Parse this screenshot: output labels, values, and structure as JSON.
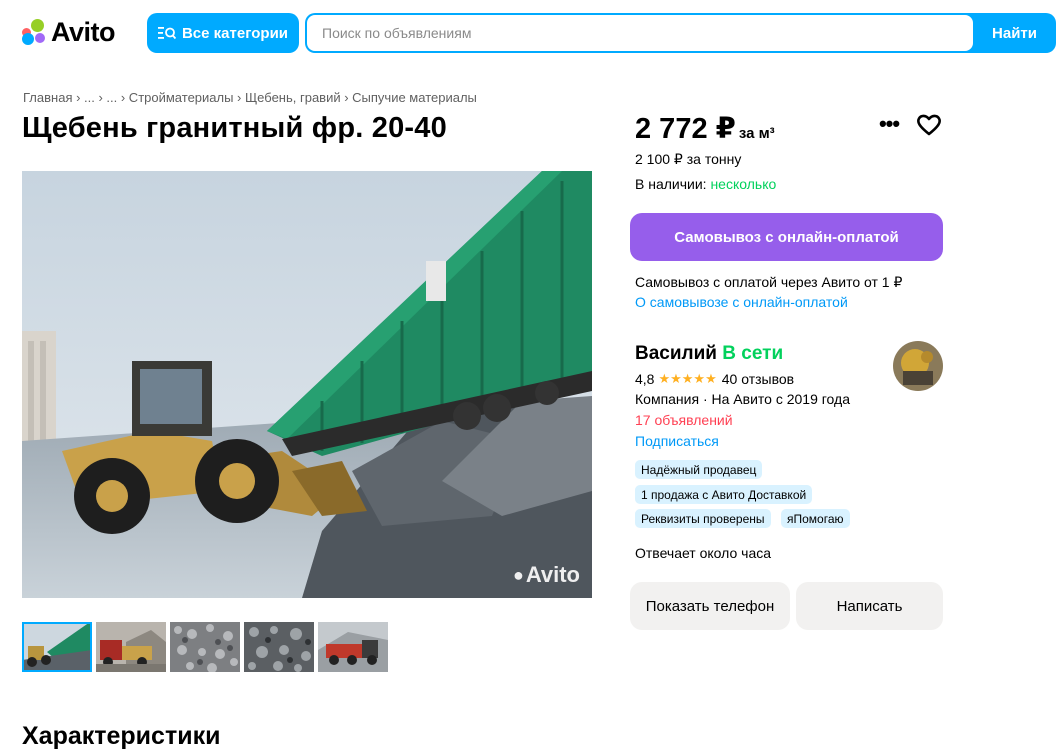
{
  "header": {
    "logo_text": "Avito",
    "categories_button": "Все категории",
    "search_placeholder": "Поиск по объявлениям",
    "search_value": "",
    "find_button": "Найти"
  },
  "breadcrumb": "Главная › ... › ... › Стройматериалы › Щебень, гравий › Сыпучие материалы",
  "title": "Щебень гранитный фр. 20-40",
  "photo": {
    "watermark": "Avito",
    "thumbnail_count": 5,
    "active_thumbnail": 1
  },
  "price": {
    "amount": "2 772 ₽",
    "unit": "за м³",
    "per_ton": "2 100 ₽ за тонну",
    "availability_label": "В наличии:",
    "availability_value": "несколько"
  },
  "pickup": {
    "button": "Самовывоз с онлайн-оплатой",
    "text": "Самовывоз с оплатой через Авито от 1 ₽",
    "link": "О самовывозе с онлайн-оплатой"
  },
  "seller": {
    "name": "Василий",
    "status": "В сети",
    "rating": "4,8",
    "stars": "★★★★★",
    "reviews": "40 отзывов",
    "company_line": "Компания · На Авито с 2019 года",
    "ads_count": "17 объявлений",
    "subscribe": "Подписаться",
    "badges": [
      "Надёжный продавец",
      "1 продажа с Авито Доставкой",
      "Реквизиты проверены",
      "яПомогаю"
    ],
    "responds": "Отвечает около часа"
  },
  "actions": {
    "show_phone": "Показать телефон",
    "write": "Написать"
  },
  "section_title": "Характеристики",
  "colors": {
    "accent_blue": "#00aaff",
    "purple": "#965eeb",
    "green": "#02d15c",
    "red": "#ff4053",
    "link": "#0099f7"
  }
}
